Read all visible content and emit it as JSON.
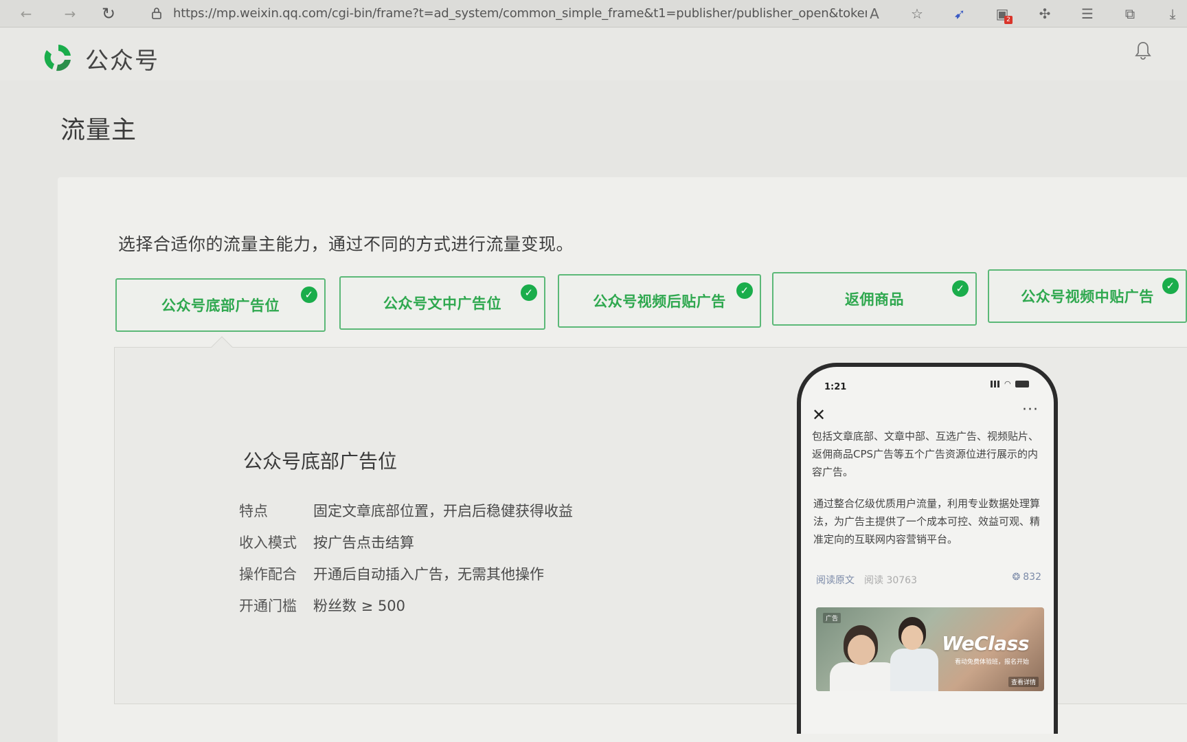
{
  "browser": {
    "url": "https://mp.weixin.qq.com/cgi-bin/frame?t=ad_system/common_simple_frame&t1=publisher/publisher_open&token...",
    "icons": [
      "back-icon",
      "forward-icon",
      "refresh-icon",
      "lock-icon",
      "read-aloud-icon",
      "favorite-add-icon",
      "extension-bird-icon",
      "extension-badge-icon",
      "extensions-icon",
      "favorites-icon",
      "collections-icon",
      "download-icon"
    ],
    "badge_count": "2"
  },
  "header": {
    "brand": "公众号",
    "logo_color": "#1aad4b"
  },
  "page": {
    "title": "流量主",
    "intro": "选择合适你的流量主能力，通过不同的方式进行流量变现。"
  },
  "tabs": [
    {
      "label": "公众号底部广告位",
      "checked": true
    },
    {
      "label": "公众号文中广告位",
      "checked": true
    },
    {
      "label": "公众号视频后贴广告",
      "checked": true
    },
    {
      "label": "返佣商品",
      "checked": true
    },
    {
      "label": "公众号视频中贴广告",
      "checked": true
    }
  ],
  "detail": {
    "title": "公众号底部广告位",
    "features": [
      {
        "key": "特点",
        "value": "固定文章底部位置，开启后稳健获得收益"
      },
      {
        "key": "收入模式",
        "value": "按广告点击结算"
      },
      {
        "key": "操作配合",
        "value": "开通后自动插入广告，无需其他操作"
      },
      {
        "key": "开通门槛",
        "value": "粉丝数 ≥ 500"
      }
    ]
  },
  "phone": {
    "time": "1:21",
    "paragraph1": "包括文章底部、文章中部、互选广告、视频贴片、返佣商品CPS广告等五个广告资源位进行展示的内容广告。",
    "paragraph2": "通过整合亿级优质用户流量，利用专业数据处理算法，为广告主提供了一个成本可控、效益可观、精准定向的互联网内容营销平台。",
    "read_original": "阅读原文",
    "reads": "阅读 30763",
    "likes": "832",
    "ad": {
      "tag": "广告",
      "brand": "WeClass",
      "subtitle": "看动免费体验班，报名开始",
      "cta": "查看详情"
    }
  },
  "colors": {
    "accent": "#1aad4b",
    "tab_border": "#5bb877",
    "tab_text": "#2fa84f"
  }
}
